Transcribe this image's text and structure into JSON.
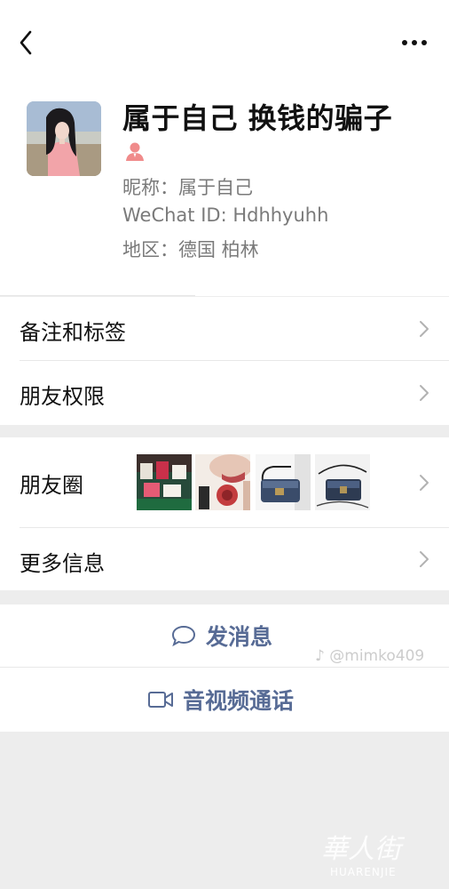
{
  "profile": {
    "name": "属于自己 换钱的骗子",
    "nickname": "昵称：属于自己",
    "wechat_id": "WeChat ID: Hdhhyuhh",
    "region": "地区：德国 柏林",
    "gender_icon": "person-icon",
    "gender_color": "#f08b8b"
  },
  "menu": {
    "remark_tags": "备注和标签",
    "friend_permissions": "朋友权限",
    "moments": "朋友圈",
    "more_info": "更多信息"
  },
  "actions": {
    "send_message": "发消息",
    "video_call": "音视频通话"
  },
  "watermarks": {
    "tiktok": "@mimko409",
    "site": "華人街",
    "site_latin": "HUARENJIE"
  },
  "colors": {
    "link_blue": "#576b95",
    "background": "#ededed"
  }
}
